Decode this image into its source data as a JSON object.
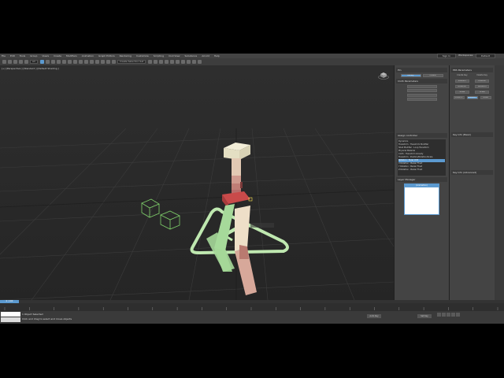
{
  "menubar": {
    "items": [
      "File",
      "Edit",
      "Tools",
      "Group",
      "Views",
      "Create",
      "Modifiers",
      "Animation",
      "Graph Editors",
      "Rendering",
      "Customize",
      "Scripting",
      "Civil View",
      "Substance",
      "Arnold",
      "Help"
    ],
    "sign_in": "Sign In",
    "workspaces_label": "Workspaces:",
    "workspace_value": "Default"
  },
  "toolbar": {
    "filter_value": "All",
    "selection_set": "Create Selection Set"
  },
  "viewport": {
    "label": "[+] [Perspective ] [Standard ] [Default Shading ]"
  },
  "command_panel": {
    "rollout_1": "Cloth Parameters",
    "pin_label": "Pin",
    "modify_btn": "Modify",
    "create_btn": "Create",
    "tree_items": [
      "Dynamics",
      "Transform : Transform Modifier",
      "Shell Modifier : Loop Transform",
      "Physical Material",
      "Cloth : Transform Gravity",
      "Transform : Position/Rotation/Scale",
      "Rotation : Euler XYZ",
      "X Rotation : Bezier Float",
      "Y Rotation : Bezier Float",
      "Z Rotation : Bezier Float"
    ],
    "selected_tree_index": 6,
    "assign_controller": "Assign controller",
    "layer_title": "Layer Manager",
    "layer_item": "(Animation)"
  },
  "command_panel2": {
    "title": "PRS Parameters",
    "create_key": "Create Key",
    "delete_key": "Delete Key",
    "position": "Position",
    "rotation": "Rotation",
    "scale": "Scale",
    "key_info_basic": "Key Info (Basic)",
    "key_info_adv": "Key Info (Advanced)"
  },
  "timeline": {
    "frame": "0 / 100",
    "ticks": [
      "0",
      "5",
      "10",
      "15",
      "20",
      "25",
      "30",
      "35",
      "40",
      "45",
      "50",
      "55",
      "60",
      "65",
      "70",
      "75",
      "80",
      "85",
      "90",
      "95",
      "100"
    ]
  },
  "statusbar": {
    "line1": "1 Object Selected",
    "line2": "Click and drag to select and move objects",
    "autokey": "Auto Key",
    "setkey": "Set Key",
    "selected": "Selected"
  },
  "colors": {
    "accent": "#5c9ad0",
    "character_green": "#a6d99a",
    "character_beige": "#e8dcc0",
    "character_red": "#c94a4a",
    "character_pink": "#d7a89a"
  }
}
